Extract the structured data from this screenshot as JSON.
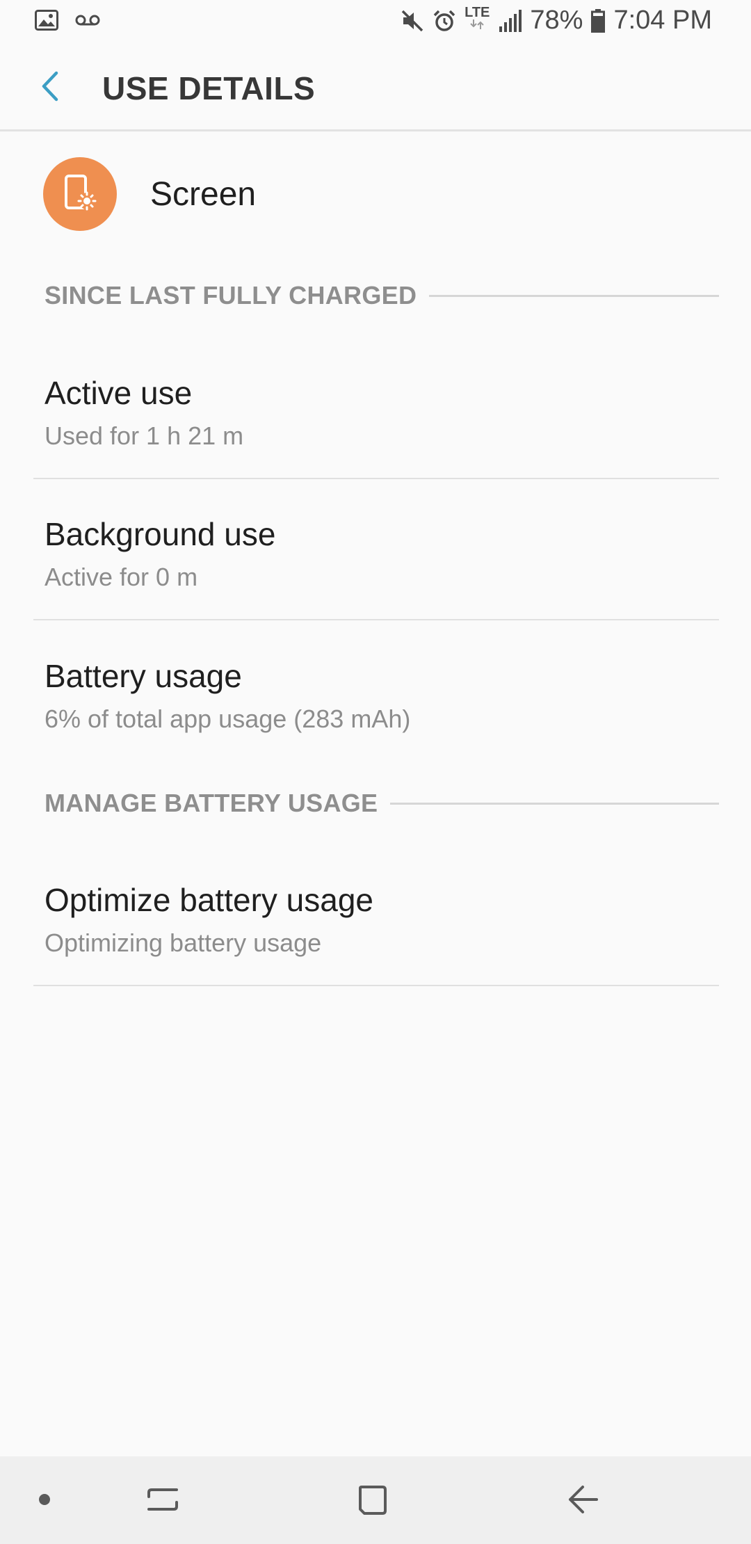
{
  "status_bar": {
    "left_icons": [
      "gallery-icon",
      "voicemail-icon"
    ],
    "right_icons": [
      "mute-icon",
      "alarm-icon",
      "lte-icon",
      "signal-icon",
      "battery-icon"
    ],
    "network_label": "LTE",
    "battery_percent": "78%",
    "time": "7:04 PM"
  },
  "app_bar": {
    "back_icon": "chevron-left-icon",
    "title": "USE DETAILS"
  },
  "entity": {
    "icon": "screen-brightness-icon",
    "icon_color": "#ef8f50",
    "name": "Screen"
  },
  "sections": {
    "since_charged": {
      "label": "SINCE LAST FULLY CHARGED",
      "items": [
        {
          "title": "Active use",
          "subtitle": "Used for 1 h 21 m"
        },
        {
          "title": "Background use",
          "subtitle": "Active for 0 m"
        },
        {
          "title": "Battery usage",
          "subtitle": "6% of total app usage (283 mAh)"
        }
      ]
    },
    "manage": {
      "label": "MANAGE BATTERY USAGE",
      "items": [
        {
          "title": "Optimize battery usage",
          "subtitle": "Optimizing battery usage"
        }
      ]
    }
  },
  "nav_bar": {
    "buttons": [
      "dot-icon",
      "recents-icon",
      "home-icon",
      "back-arrow-icon"
    ]
  },
  "colors": {
    "accent": "#3c9ec4",
    "background": "#fafafa",
    "nav_background": "#efefef"
  }
}
